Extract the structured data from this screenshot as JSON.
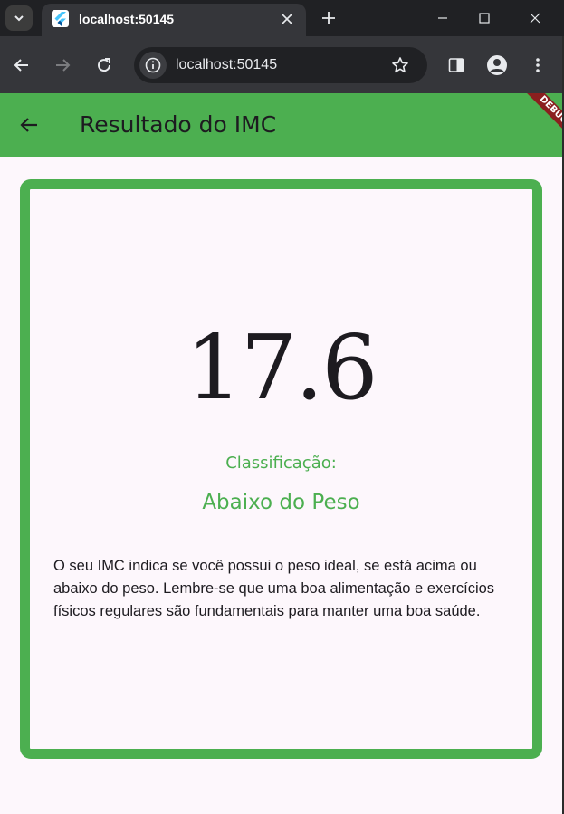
{
  "browser": {
    "tab_title": "localhost:50145",
    "url": "localhost:50145",
    "icons": {
      "tab_search": "chevron-down-icon",
      "favicon": "flutter-icon",
      "tab_close": "close-icon",
      "new_tab": "plus-icon",
      "minimize": "minimize-icon",
      "maximize": "maximize-icon",
      "window_close": "close-icon",
      "back": "arrow-left-icon",
      "forward": "arrow-right-icon",
      "reload": "reload-icon",
      "site_info": "info-icon",
      "bookmark": "star-icon",
      "side_panel": "side-panel-icon",
      "profile": "profile-icon",
      "menu": "kebab-menu-icon"
    }
  },
  "app": {
    "title": "Resultado do IMC",
    "debug_banner": "DEBUG",
    "back_icon": "arrow-back-icon",
    "imc_value": "17.6",
    "classification_label": "Classificação:",
    "classification_value": "Abaixo do Peso",
    "description": "O seu IMC indica se você possui o peso ideal, se está acima ou abaixo do peso. Lembre-se que uma boa alimentação e exercícios físicos regulares são fundamentais para manter uma boa saúde."
  },
  "colors": {
    "accent_green": "#4caf50",
    "background": "#fdf7fc",
    "debug_banner": "#8b1f1f",
    "chrome_dark": "#202124",
    "chrome_toolbar": "#35363a"
  }
}
